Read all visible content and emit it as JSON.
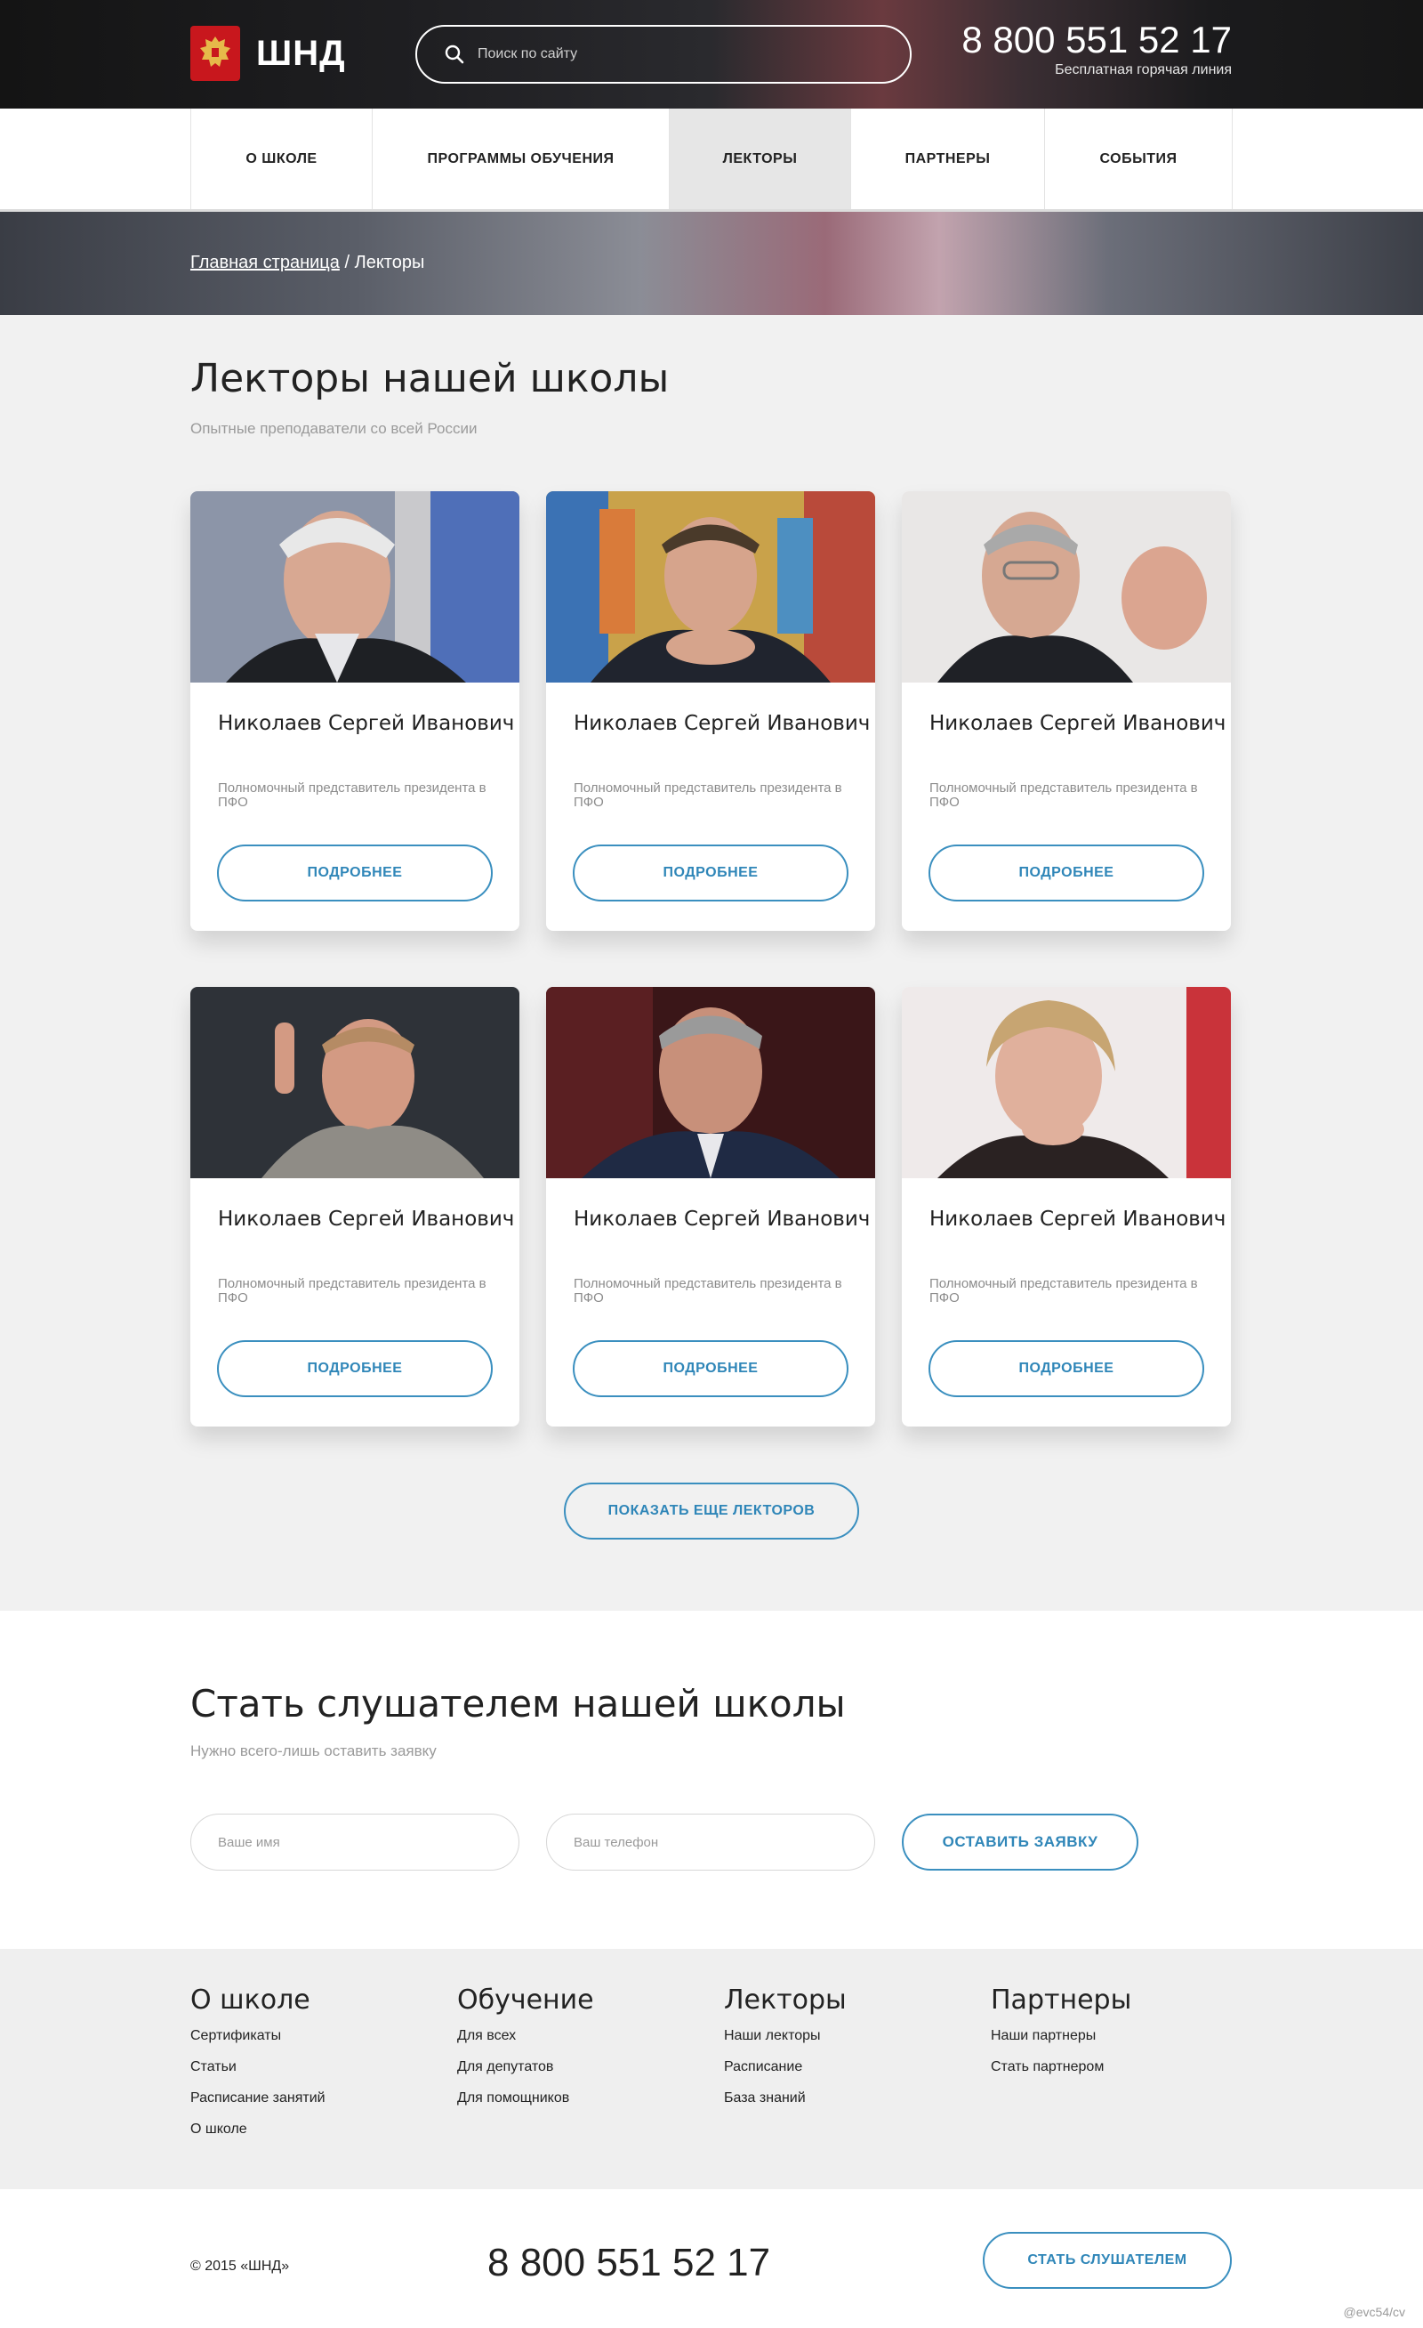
{
  "header": {
    "logo_text": "ШНД",
    "search_placeholder": "Поиск по сайту",
    "phone": "8 800 551 52 17",
    "phone_caption": "Бесплатная горячая линия"
  },
  "nav": {
    "items": [
      {
        "label": "О ШКОЛЕ"
      },
      {
        "label": "ПРОГРАММЫ ОБУЧЕНИЯ"
      },
      {
        "label": "ЛЕКТОРЫ"
      },
      {
        "label": "ПАРТНЕРЫ"
      },
      {
        "label": "СОБЫТИЯ"
      }
    ],
    "active_index": 2
  },
  "breadcrumb": {
    "home": "Главная страница",
    "separator": "/",
    "current": "Лекторы"
  },
  "lecturers": {
    "title": "Лекторы нашей школы",
    "subtitle": "Опытные преподаватели со всей России",
    "cards": [
      {
        "name": "Николаев Сергей Иванович",
        "role": "Полномочный представитель президента в ПФО",
        "button": "ПОДРОБНЕЕ"
      },
      {
        "name": "Николаев Сергей Иванович",
        "role": "Полномочный представитель президента в ПФО",
        "button": "ПОДРОБНЕЕ"
      },
      {
        "name": "Николаев Сергей Иванович",
        "role": "Полномочный представитель президента в ПФО",
        "button": "ПОДРОБНЕЕ"
      },
      {
        "name": "Николаев Сергей Иванович",
        "role": "Полномочный представитель президента в ПФО",
        "button": "ПОДРОБНЕЕ"
      },
      {
        "name": "Николаев Сергей Иванович",
        "role": "Полномочный представитель президента в ПФО",
        "button": "ПОДРОБНЕЕ"
      },
      {
        "name": "Николаев Сергей Иванович",
        "role": "Полномочный представитель президента в ПФО",
        "button": "ПОДРОБНЕЕ"
      }
    ],
    "more_button": "ПОКАЗАТЬ ЕЩЕ ЛЕКТОРОВ"
  },
  "subscribe": {
    "title": "Стать слушателем нашей школы",
    "subtitle": "Нужно всего-лишь оставить заявку",
    "name_placeholder": "Ваше имя",
    "phone_placeholder": "Ваш телефон",
    "submit": "ОСТАВИТЬ ЗАЯВКУ"
  },
  "footer": {
    "columns": [
      {
        "title": "О школе",
        "links": [
          "Сертификаты",
          "Статьи",
          "Расписание занятий",
          "О школе"
        ]
      },
      {
        "title": "Обучение",
        "links": [
          "Для всех",
          "Для депутатов",
          "Для помощников"
        ]
      },
      {
        "title": "Лекторы",
        "links": [
          "Наши лекторы",
          "Расписание",
          "База знаний"
        ]
      },
      {
        "title": "Партнеры",
        "links": [
          "Наши партнеры",
          "Стать партнером"
        ]
      }
    ],
    "copyright": "© 2015 «ШНД»",
    "phone": "8 800 551 52 17",
    "join_button": "СТАТЬ СЛУШАТЕЛЕМ",
    "credit": "@evc54/cv"
  },
  "colors": {
    "accent": "#2f86b8",
    "emblem_red": "#c8171d",
    "background": "#f1f1f1"
  }
}
